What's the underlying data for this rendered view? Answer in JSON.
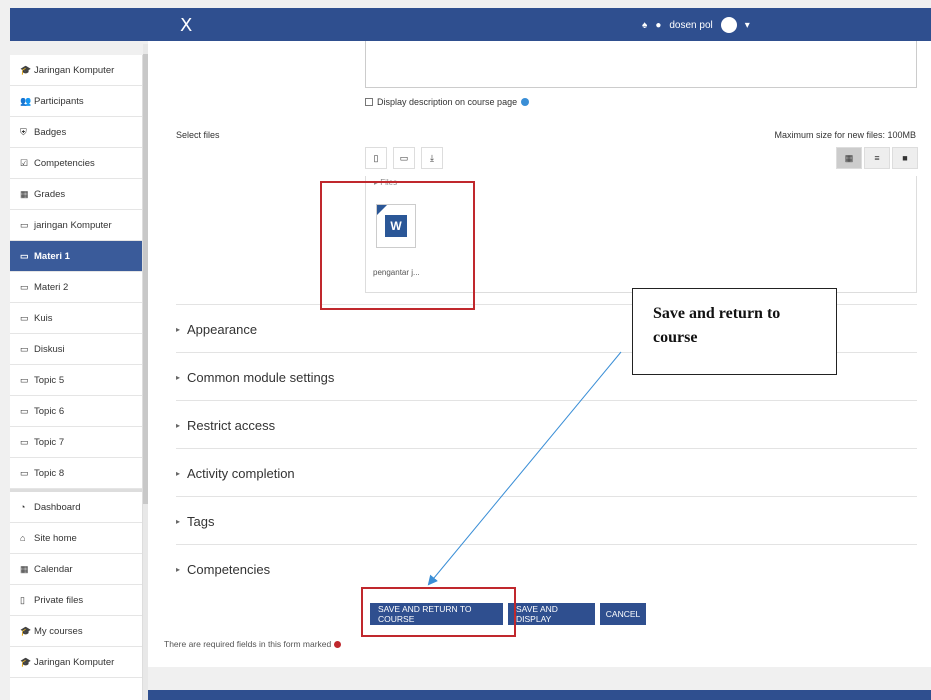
{
  "topbar": {
    "close_glyph": "X",
    "username": "dosen pol"
  },
  "sidebar": {
    "items": [
      {
        "icon": "graduation-cap-icon",
        "glyph": "🎓",
        "label": "Jaringan Komputer"
      },
      {
        "icon": "users-icon",
        "glyph": "👥",
        "label": "Participants"
      },
      {
        "icon": "shield-icon",
        "glyph": "⛨",
        "label": "Badges"
      },
      {
        "icon": "checkbox-icon",
        "glyph": "☑",
        "label": "Competencies"
      },
      {
        "icon": "table-icon",
        "glyph": "▦",
        "label": "Grades"
      },
      {
        "icon": "folder-icon",
        "glyph": "▭",
        "label": "jaringan Komputer"
      },
      {
        "icon": "folder-icon",
        "glyph": "▭",
        "label": "Materi 1"
      },
      {
        "icon": "folder-icon",
        "glyph": "▭",
        "label": "Materi 2"
      },
      {
        "icon": "folder-icon",
        "glyph": "▭",
        "label": "Kuis"
      },
      {
        "icon": "folder-icon",
        "glyph": "▭",
        "label": "Diskusi"
      },
      {
        "icon": "folder-icon",
        "glyph": "▭",
        "label": "Topic 5"
      },
      {
        "icon": "folder-icon",
        "glyph": "▭",
        "label": "Topic 6"
      },
      {
        "icon": "folder-icon",
        "glyph": "▭",
        "label": "Topic 7"
      },
      {
        "icon": "folder-icon",
        "glyph": "▭",
        "label": "Topic 8"
      }
    ],
    "nav": [
      {
        "icon": "dashboard-icon",
        "glyph": "◔",
        "label": "Dashboard"
      },
      {
        "icon": "home-icon",
        "glyph": "⌂",
        "label": "Site home"
      },
      {
        "icon": "calendar-icon",
        "glyph": "▦",
        "label": "Calendar"
      },
      {
        "icon": "file-icon",
        "glyph": "▯",
        "label": "Private files"
      },
      {
        "icon": "graduation-cap-icon",
        "glyph": "🎓",
        "label": "My courses"
      },
      {
        "icon": "graduation-cap-icon",
        "glyph": "🎓",
        "label": "Jaringan Komputer"
      }
    ],
    "active_label": "Materi 1"
  },
  "form": {
    "display_description_label": "Display description on course page",
    "select_files_label": "Select files",
    "max_size": "Maximum size for new files: 100MB",
    "files_header": "▸ Files",
    "file_name": "pengantar j...",
    "sections": [
      "Appearance",
      "Common module settings",
      "Restrict access",
      "Activity completion",
      "Tags",
      "Competencies"
    ],
    "buttons": {
      "save_return": "SAVE AND RETURN TO COURSE",
      "save_display": "SAVE AND DISPLAY",
      "cancel": "CANCEL"
    },
    "required_note": "There are required fields in this form marked"
  },
  "annotation": {
    "callout_text": "Save and return to course",
    "highlight_color": "#c0282d",
    "arrow_color": "#3a8ed6"
  },
  "colors": {
    "brand": "#2f4f8f",
    "active_sidebar": "#3a5b9a"
  }
}
